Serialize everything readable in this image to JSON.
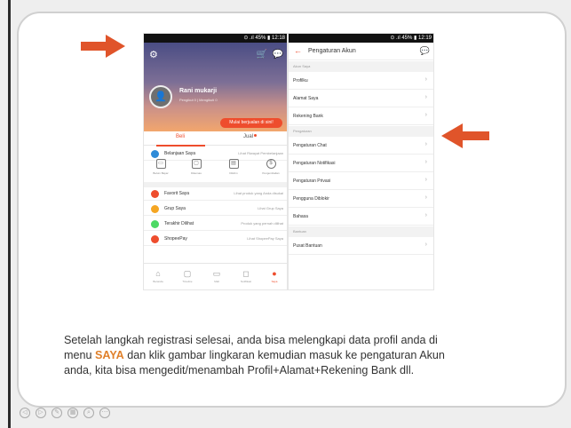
{
  "phone1": {
    "status_bar": "⊙ .ıl 45% ▮ 12:18",
    "profile": {
      "name": "Rani mukarji",
      "stats": "Pengikut 0 | Mengikuti 0"
    },
    "sell_button": "Mulai berjualan di sini!",
    "tabs": [
      "Beli",
      "Jual"
    ],
    "purchases": {
      "label": "Belanjaan Saya",
      "hint": "Lihat Riwayat Pembelanjaan"
    },
    "status_icons": [
      {
        "label": "Belum Bayar",
        "icon": "wallet-icon"
      },
      {
        "label": "Dikemas",
        "icon": "box-icon"
      },
      {
        "label": "Dikirim",
        "icon": "truck-icon"
      },
      {
        "label": "Pengembalian",
        "icon": "return-icon"
      }
    ],
    "menu": [
      {
        "label": "Favorit Saya",
        "hint": "Lihat produk yang Anda disukai",
        "color": "#ee4d2d"
      },
      {
        "label": "Grup Saya",
        "hint": "Lihat Grup Saya",
        "color": "#f5a623"
      },
      {
        "label": "Terakhir Dilihat",
        "hint": "Produk yang pernah dilihat",
        "color": "#4cd964"
      },
      {
        "label": "ShopeePay",
        "hint": "Lihat ShopeePay Saya",
        "color": "#ee4d2d"
      }
    ],
    "nav": [
      "Beranda",
      "Timeline",
      "Mall",
      "Notifikasi",
      "Saya"
    ]
  },
  "phone2": {
    "status_bar": "⊙ .ıl 45% ▮ 12:19",
    "title": "Pengaturan Akun",
    "sections": [
      {
        "header": "Akun Saya",
        "items": [
          "Profilku",
          "Alamat Saya",
          "Rekening Bank"
        ]
      },
      {
        "header": "Pengaturan",
        "items": [
          "Pengaturan Chat",
          "Pengaturan Notifikasi",
          "Pengaturan Privasi",
          "Pengguna Diblokir",
          "Bahasa"
        ]
      },
      {
        "header": "Bantuan",
        "items": [
          "Pusat Bantuan"
        ]
      }
    ]
  },
  "text": {
    "line1": "Setelah langkah registrasi selesai, anda bisa melengkapi data profil anda di",
    "line2_pre": "menu ",
    "line2_hl": "SAYA",
    "line2_post": " dan klik gambar lingkaran kemudian masuk ke pengaturan Akun",
    "line3": "anda, kita bisa mengedit/menambah Profil+Alamat+Rekening Bank dll."
  },
  "colors": {
    "accent": "#ee4d2d",
    "arrow": "#e0542a",
    "highlight": "#e0802a"
  }
}
